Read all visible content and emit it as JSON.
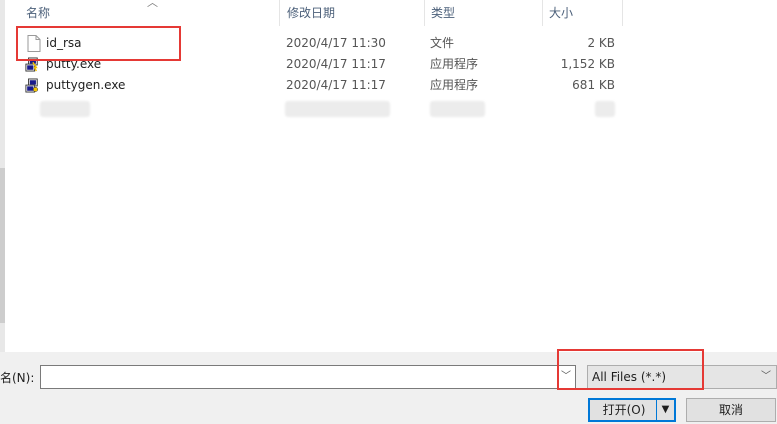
{
  "columns": {
    "name": "名称",
    "modified": "修改日期",
    "type": "类型",
    "size": "大小"
  },
  "files": [
    {
      "name": "id_rsa",
      "modified": "2020/4/17 11:30",
      "type": "文件",
      "size": "2 KB",
      "icon": "document-icon"
    },
    {
      "name": "putty.exe",
      "modified": "2020/4/17 11:17",
      "type": "应用程序",
      "size": "1,152 KB",
      "icon": "putty-icon"
    },
    {
      "name": "puttygen.exe",
      "modified": "2020/4/17 11:17",
      "type": "应用程序",
      "size": "681 KB",
      "icon": "puttygen-icon"
    }
  ],
  "filename": {
    "label": "名(N):",
    "value": ""
  },
  "filter": {
    "selected": "All Files (*.*)"
  },
  "buttons": {
    "open": "打开(O)",
    "cancel": "取消"
  },
  "colors": {
    "highlight_box": "#e53935",
    "accent": "#0078d7"
  }
}
